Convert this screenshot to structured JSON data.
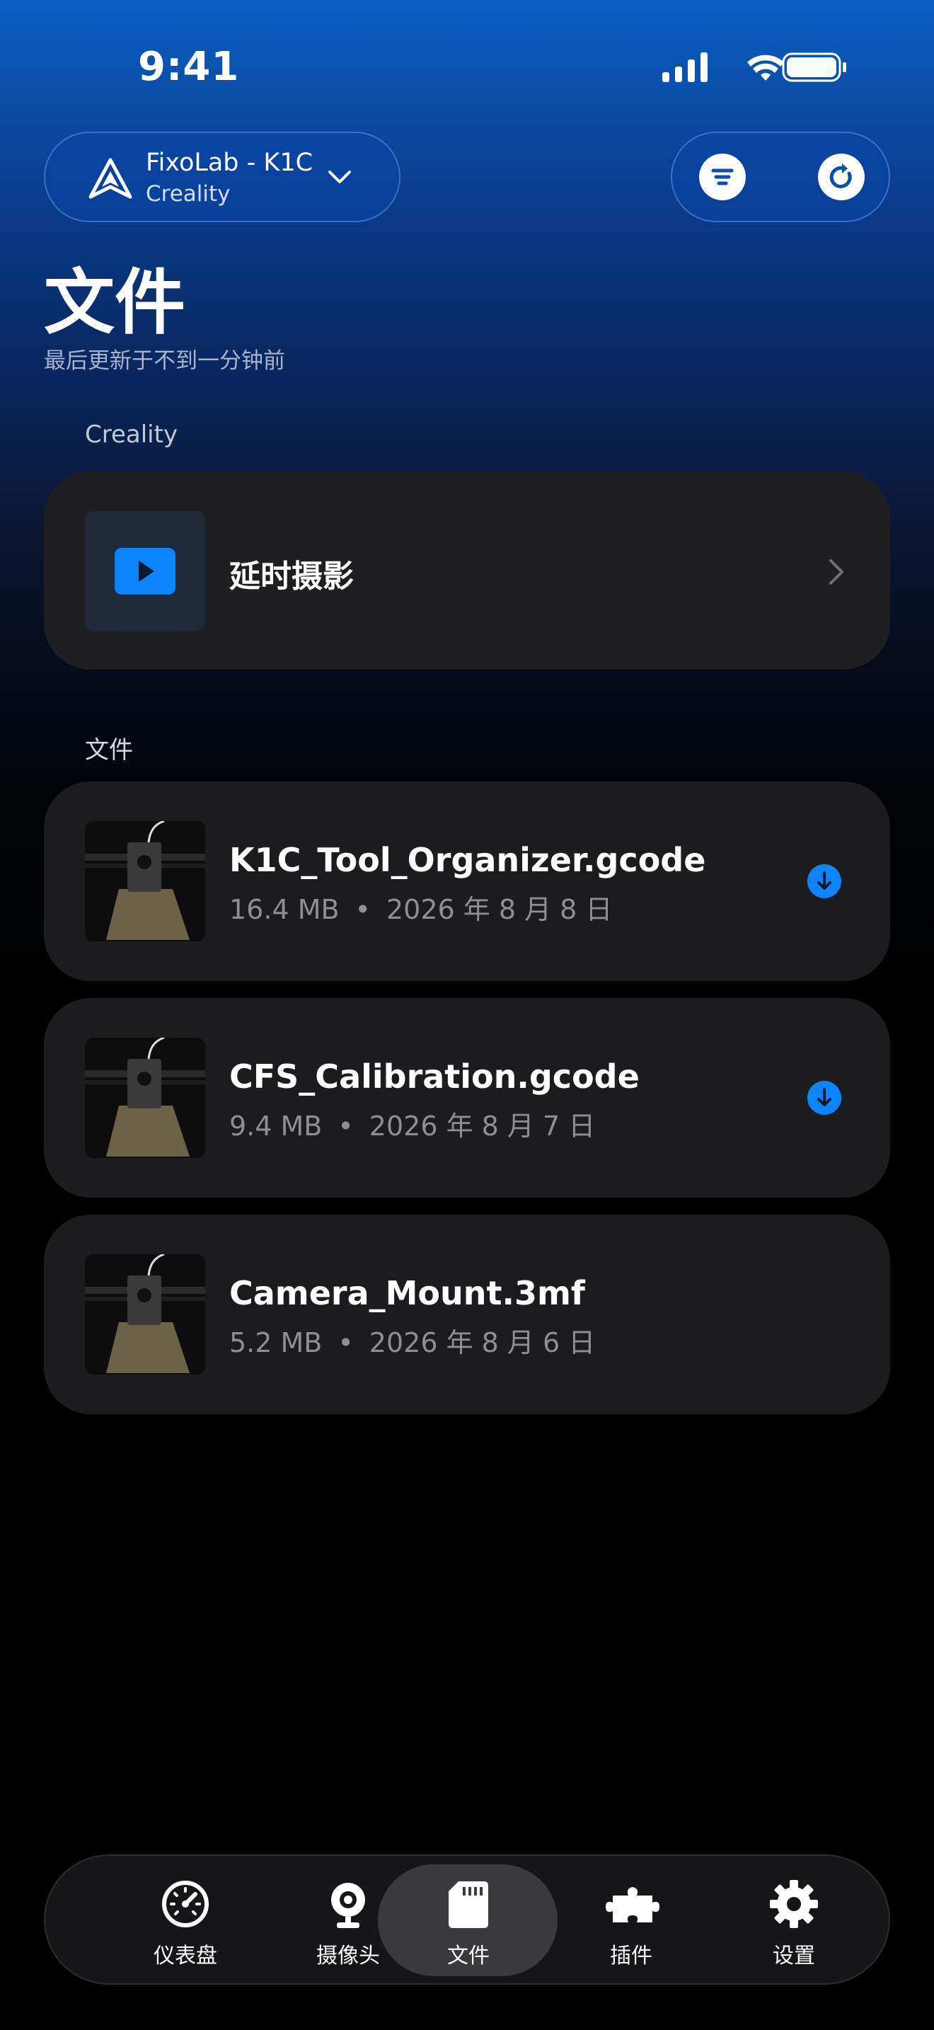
{
  "status_bar": {
    "time": "9:41"
  },
  "printer": {
    "name": "FixoLab - K1C",
    "brand": "Creality"
  },
  "header": {
    "title": "文件",
    "subtitle": "最后更新于不到一分钟前"
  },
  "sections": {
    "creality": "Creality",
    "files": "文件"
  },
  "timelapse": {
    "label": "延时摄影"
  },
  "files": [
    {
      "name": "K1C_Tool_Organizer.gcode",
      "size": "16.4 MB",
      "date": "2026 年 8 月 8 日",
      "downloadable": true
    },
    {
      "name": "CFS_Calibration.gcode",
      "size": "9.4 MB",
      "date": "2026 年 8 月 7 日",
      "downloadable": true
    },
    {
      "name": "Camera_Mount.3mf",
      "size": "5.2 MB",
      "date": "2026 年 8 月 6 日",
      "downloadable": false
    }
  ],
  "meta_separator": "•",
  "tabs": [
    {
      "label": "仪表盘",
      "icon": "speedometer-icon"
    },
    {
      "label": "摄像头",
      "icon": "webcam-icon"
    },
    {
      "label": "文件",
      "icon": "sd-card-icon",
      "active": true
    },
    {
      "label": "插件",
      "icon": "puzzle-icon"
    },
    {
      "label": "设置",
      "icon": "gear-icon"
    }
  ],
  "colors": {
    "accent": "#0b84ff",
    "card": "#1c1c1e",
    "header_blue": "#0a5fc4"
  }
}
